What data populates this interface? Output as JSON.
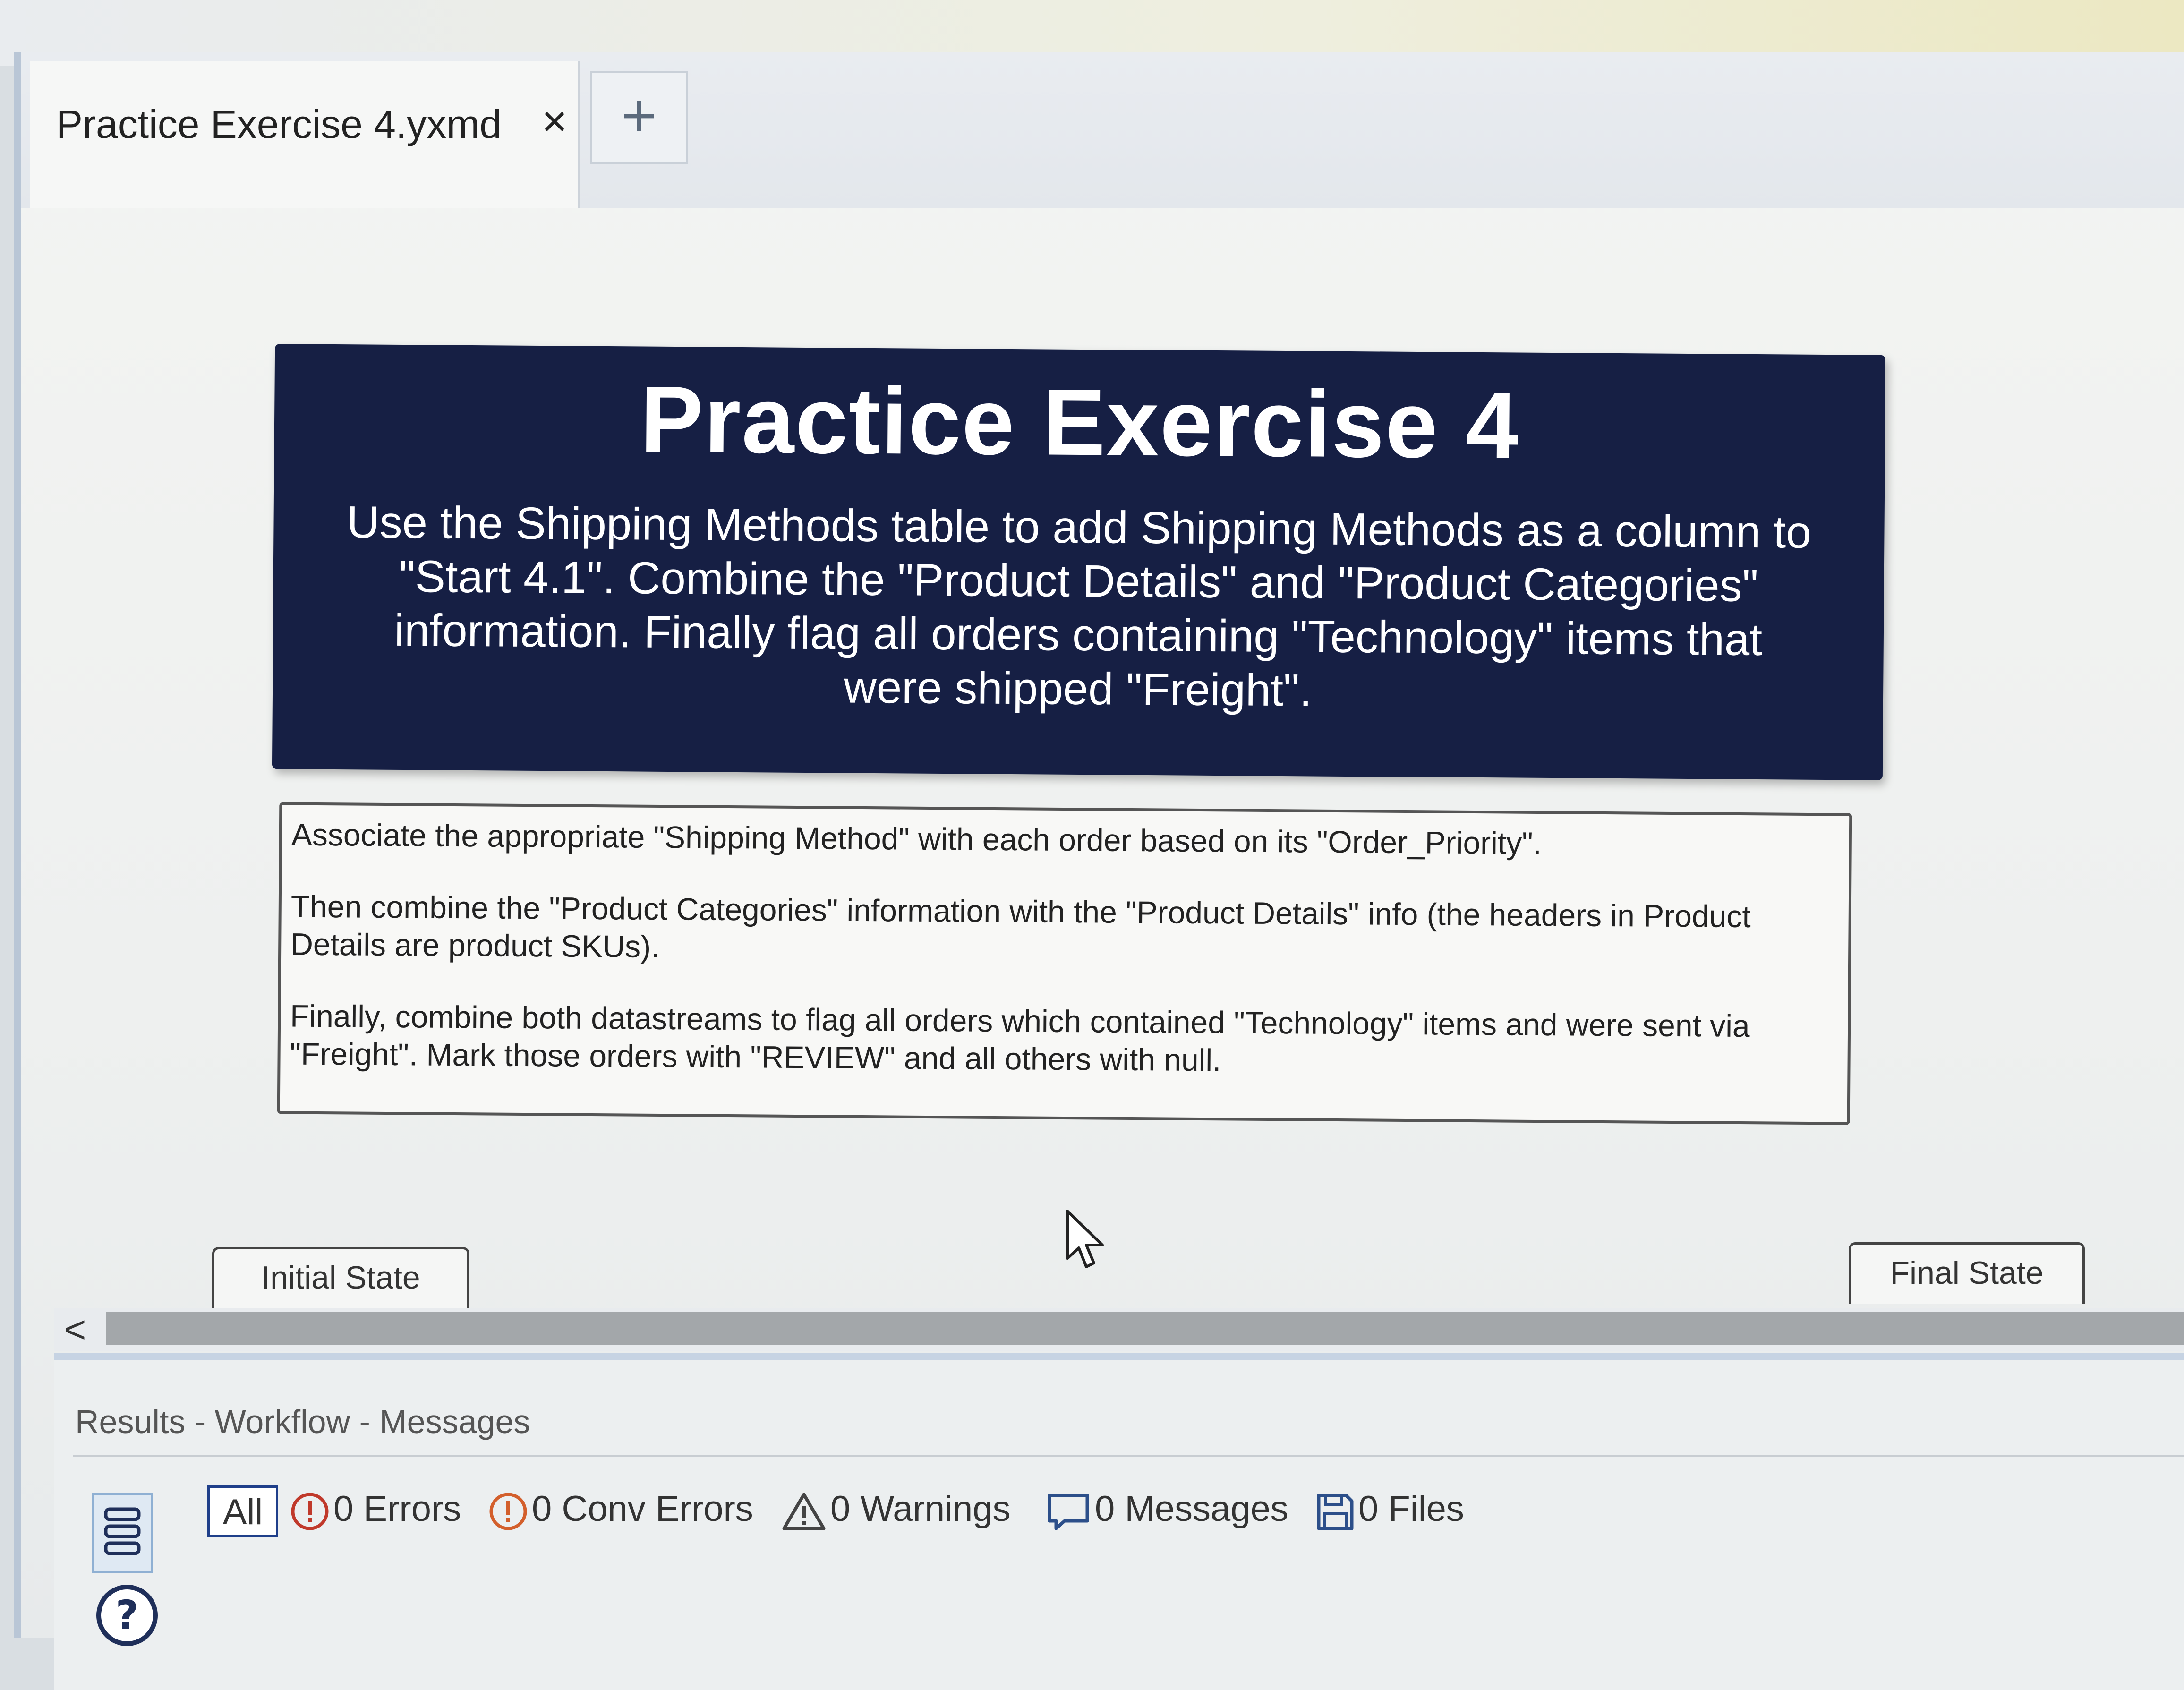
{
  "tab": {
    "title": "Practice Exercise 4.yxmd",
    "close_label": "×",
    "new_tab_label": "+"
  },
  "canvas": {
    "title_box": {
      "heading": "Practice Exercise 4",
      "description": "Use the Shipping Methods table to add Shipping Methods as a column to \"Start 4.1\". Combine the \"Product Details\" and \"Product Categories\" information.  Finally flag all orders containing \"Technology\" items that were shipped \"Freight\"."
    },
    "comment_box": {
      "paragraphs": [
        "Associate the appropriate \"Shipping Method\" with each order based on its \"Order_Priority\".",
        "Then combine the \"Product Categories\" information with the \"Product Details\" info (the headers in Product Details are product SKUs).",
        "Finally, combine both datastreams to flag all orders which contained \"Technology\" items and were sent via \"Freight\". Mark those orders with \"REVIEW\" and all others with null."
      ]
    },
    "initial_state_label": "Initial State",
    "final_state_label": "Final State"
  },
  "scrollbar": {
    "left_arrow": "<"
  },
  "results": {
    "title": "Results - Workflow - Messages",
    "filters": {
      "all": "All",
      "errors": "0 Errors",
      "conv_errors": "0 Conv Errors",
      "warnings": "0 Warnings",
      "messages": "0 Messages",
      "files": "0 Files"
    }
  },
  "colors": {
    "title_box_bg": "#161f44",
    "error_icon": "#c0392b",
    "conv_error_icon": "#d35f2c",
    "accent_blue": "#1f3f8a"
  }
}
